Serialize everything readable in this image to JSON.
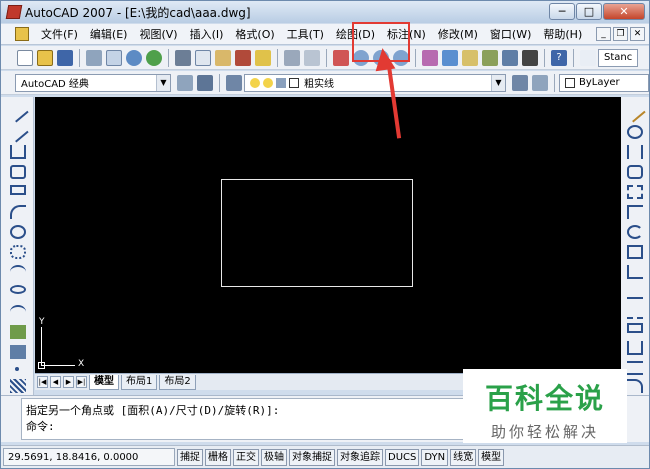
{
  "window": {
    "title": "AutoCAD 2007 - [E:\\我的cad\\aaa.dwg]",
    "minimize": "─",
    "maximize": "□",
    "close": "✕"
  },
  "menubar": {
    "items": [
      "文件(F)",
      "编辑(E)",
      "视图(V)",
      "插入(I)",
      "格式(O)",
      "工具(T)",
      "绘图(D)",
      "标注(N)",
      "修改(M)",
      "窗口(W)",
      "帮助(H)"
    ]
  },
  "mdi": {
    "minimize": "_",
    "restore": "❐",
    "close": "✕"
  },
  "toolbar2": {
    "workspace": "AutoCAD 经典",
    "layer": "粗实线",
    "linecolor": "ByLayer"
  },
  "standard_combo": "Stanc",
  "ucs": {
    "x_label": "X",
    "y_label": "Y"
  },
  "layout_tabs": [
    "模型",
    "布局1",
    "布局2"
  ],
  "nav": [
    "|◀",
    "◀",
    "▶",
    "▶|"
  ],
  "command": {
    "line1": "指定另一个角点或 [面积(A)/尺寸(D)/旋转(R)]:",
    "line2": "命令:"
  },
  "status": {
    "coords": "29.5691, 18.8416, 0.0000",
    "buttons": [
      "捕捉",
      "栅格",
      "正交",
      "极轴",
      "对象捕捉",
      "对象追踪",
      "DUCS",
      "DYN",
      "线宽",
      "模型"
    ]
  },
  "watermark": {
    "title": "百科全说",
    "subtitle": "助你轻松解决"
  },
  "colors": {
    "highlight": "#e23a33",
    "canvas": "#000000",
    "watermark_green": "#2aa149"
  }
}
